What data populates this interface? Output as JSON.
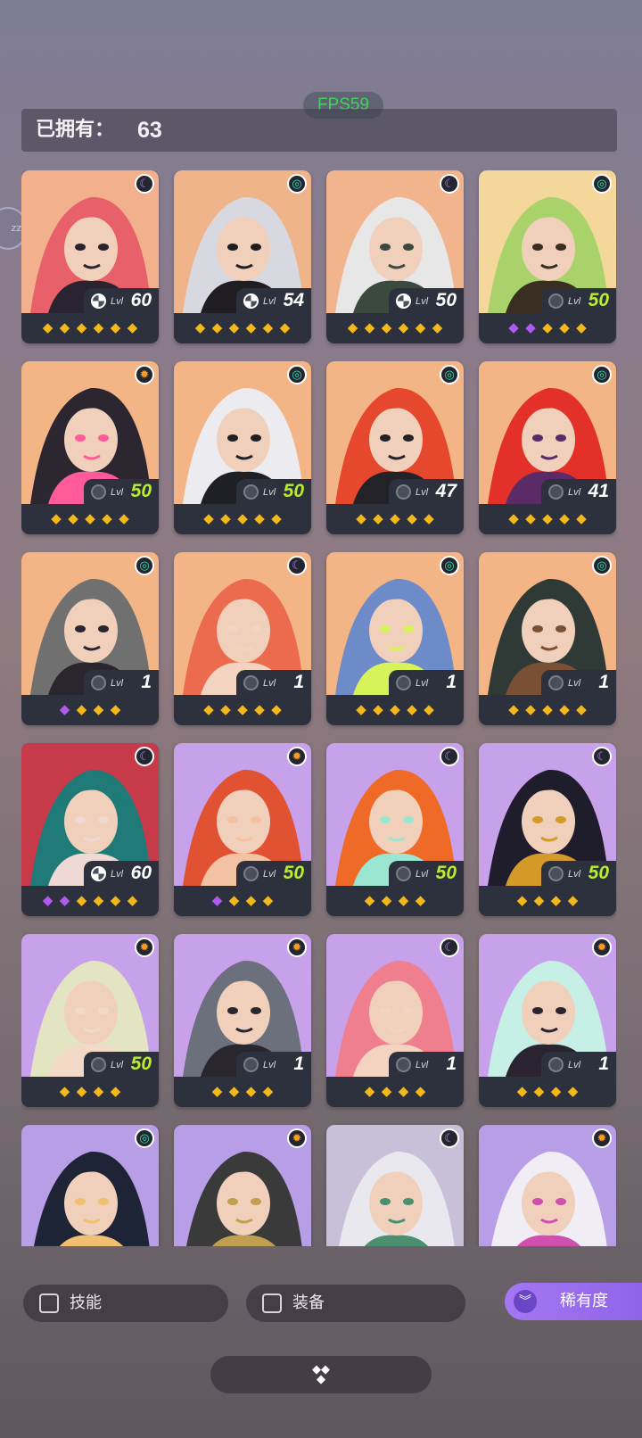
{
  "fps": "FPS59",
  "header": {
    "owned_label": "已拥有：",
    "owned_count": "63"
  },
  "side_bubble": "zz",
  "cards": [
    {
      "element": "lunar",
      "level": "60",
      "level_color": "white",
      "stars": [
        1,
        1,
        1,
        1,
        1,
        1
      ],
      "palette": [
        "#f2b08c",
        "#e8606a",
        "#2a2430"
      ],
      "level_label": "Lvl"
    },
    {
      "element": "wind",
      "level": "54",
      "level_color": "white",
      "stars": [
        1,
        1,
        1,
        1,
        1,
        1
      ],
      "palette": [
        "#f0b48a",
        "#d8d8e0",
        "#1f1c22"
      ],
      "level_label": "Lvl"
    },
    {
      "element": "lunar",
      "level": "50",
      "level_color": "white",
      "stars": [
        1,
        1,
        1,
        1,
        1,
        1
      ],
      "palette": [
        "#f2b48c",
        "#e7e7e7",
        "#3b4a3e"
      ],
      "level_label": "Lvl"
    },
    {
      "element": "wind",
      "level": "50",
      "level_color": "green",
      "stars": [
        2,
        2,
        1,
        1,
        1
      ],
      "palette": [
        "#f4d79a",
        "#a9d36a",
        "#3a2d22"
      ],
      "level_label": "Lvl"
    },
    {
      "element": "solar",
      "level": "50",
      "level_color": "green",
      "stars": [
        1,
        1,
        1,
        1,
        1
      ],
      "palette": [
        "#f3b486",
        "#2b2630",
        "#ff5a9a"
      ],
      "level_label": "Lvl"
    },
    {
      "element": "wind",
      "level": "50",
      "level_color": "green",
      "stars": [
        1,
        1,
        1,
        1,
        1
      ],
      "palette": [
        "#f3b486",
        "#ececf0",
        "#1f1f26"
      ],
      "level_label": "Lvl"
    },
    {
      "element": "wind",
      "level": "47",
      "level_color": "white",
      "stars": [
        1,
        1,
        1,
        1,
        1
      ],
      "palette": [
        "#f3b486",
        "#e5482c",
        "#232228"
      ],
      "level_label": "Lvl"
    },
    {
      "element": "wind",
      "level": "41",
      "level_color": "white",
      "stars": [
        1,
        1,
        1,
        1,
        1
      ],
      "palette": [
        "#f3b486",
        "#e3312a",
        "#5a2b66"
      ],
      "level_label": "Lvl"
    },
    {
      "element": "wind",
      "level": "1",
      "level_color": "white",
      "stars": [
        2,
        1,
        1,
        1
      ],
      "palette": [
        "#f3b486",
        "#707070",
        "#2a2630"
      ],
      "level_label": "Lvl"
    },
    {
      "element": "lunar",
      "level": "1",
      "level_color": "white",
      "stars": [
        1,
        1,
        1,
        1,
        1
      ],
      "palette": [
        "#f3b486",
        "#ec6a4e",
        "#f3d4c0"
      ],
      "level_label": "Lvl"
    },
    {
      "element": "wind",
      "level": "1",
      "level_color": "white",
      "stars": [
        1,
        1,
        1,
        1,
        1
      ],
      "palette": [
        "#f3b486",
        "#6d8bc8",
        "#d8f25a"
      ],
      "level_label": "Lvl"
    },
    {
      "element": "wind",
      "level": "1",
      "level_color": "white",
      "stars": [
        1,
        1,
        1,
        1,
        1
      ],
      "palette": [
        "#f3b486",
        "#2f3a36",
        "#7a5034"
      ],
      "level_label": "Lvl"
    },
    {
      "element": "lunar",
      "level": "60",
      "level_color": "white",
      "stars": [
        2,
        2,
        1,
        1,
        1,
        1
      ],
      "palette": [
        "#c63a4a",
        "#1f7a78",
        "#f0d9d4"
      ],
      "level_label": "Lvl"
    },
    {
      "element": "solar",
      "level": "50",
      "level_color": "green",
      "stars": [
        2,
        1,
        1,
        1
      ],
      "palette": [
        "#c7a2ea",
        "#e05232",
        "#f3c2a2"
      ],
      "level_label": "Lvl"
    },
    {
      "element": "lunar",
      "level": "50",
      "level_color": "green",
      "stars": [
        1,
        1,
        1,
        1
      ],
      "palette": [
        "#c7a2ea",
        "#ef6a26",
        "#9be6d0"
      ],
      "level_label": "Lvl"
    },
    {
      "element": "lunar",
      "level": "50",
      "level_color": "green",
      "stars": [
        1,
        1,
        1,
        1
      ],
      "palette": [
        "#c7a2ea",
        "#1f1d2c",
        "#d39a2a"
      ],
      "level_label": "Lvl"
    },
    {
      "element": "solar",
      "level": "50",
      "level_color": "green",
      "stars": [
        1,
        1,
        1,
        1
      ],
      "palette": [
        "#c7a2ea",
        "#e2e4c2",
        "#f2d9c8"
      ],
      "level_label": "Lvl"
    },
    {
      "element": "solar",
      "level": "1",
      "level_color": "white",
      "stars": [
        1,
        1,
        1,
        1
      ],
      "palette": [
        "#c7a2ea",
        "#6b707c",
        "#2a2630"
      ],
      "level_label": "Lvl"
    },
    {
      "element": "lunar",
      "level": "1",
      "level_color": "white",
      "stars": [
        1,
        1,
        1,
        1
      ],
      "palette": [
        "#c7a2ea",
        "#ef7f8e",
        "#f4d3c0"
      ],
      "level_label": "Lvl"
    },
    {
      "element": "solar",
      "level": "1",
      "level_color": "white",
      "stars": [
        1,
        1,
        1,
        1
      ],
      "palette": [
        "#c7a2ea",
        "#c6efe6",
        "#2a2430"
      ],
      "level_label": "Lvl"
    },
    {
      "element": "wind",
      "palette": [
        "#b89ee6",
        "#1d2436",
        "#f0c070"
      ]
    },
    {
      "element": "solar",
      "palette": [
        "#b89ee6",
        "#3a3a3a",
        "#c0a050"
      ]
    },
    {
      "element": "lunar",
      "palette": [
        "#c8c0d8",
        "#e8e8ee",
        "#4a9070"
      ]
    },
    {
      "element": "solar",
      "palette": [
        "#b89ee6",
        "#f0eef4",
        "#d050b0"
      ]
    }
  ],
  "filters": {
    "skills": "技能",
    "equipment": "装备",
    "rarity": "稀有度"
  },
  "icons": {
    "element_lunar": "lunar-icon",
    "element_wind": "wind-swirl-icon",
    "element_solar": "sun-gear-icon"
  }
}
